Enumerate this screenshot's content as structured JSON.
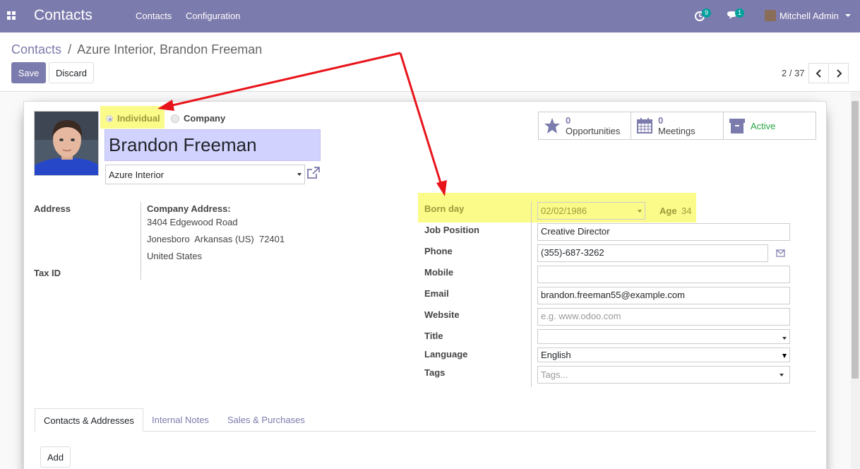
{
  "navbar": {
    "brand": "Contacts",
    "menu": [
      "Contacts",
      "Configuration"
    ],
    "activity_count": "9",
    "message_count": "1",
    "user": "Mitchell Admin"
  },
  "breadcrumb": {
    "parent": "Contacts",
    "separator": "/",
    "current": "Azure Interior, Brandon Freeman"
  },
  "actions": {
    "save": "Save",
    "discard": "Discard"
  },
  "pager": {
    "value": "2 / 37"
  },
  "form": {
    "type_individual": "Individual",
    "type_company": "Company",
    "name": "Brandon Freeman",
    "company": "Azure Interior",
    "stats": {
      "opportunities_count": "0",
      "opportunities_label": "Opportunities",
      "meetings_count": "0",
      "meetings_label": "Meetings",
      "active_label": "Active"
    },
    "left": {
      "address_label": "Address",
      "company_address_label": "Company Address:",
      "street": "3404 Edgewood Road",
      "city_line": "Jonesboro  Arkansas (US)  72401",
      "country": "United States",
      "tax_id_label": "Tax ID"
    },
    "right": {
      "born_day_label": "Born day",
      "born_day_value": "02/02/1986",
      "age_label": "Age",
      "age_value": "34",
      "job_position_label": "Job Position",
      "job_position_value": "Creative Director",
      "phone_label": "Phone",
      "phone_value": "(355)-687-3262",
      "mobile_label": "Mobile",
      "mobile_value": "",
      "email_label": "Email",
      "email_value": "brandon.freeman55@example.com",
      "website_label": "Website",
      "website_placeholder": "e.g. www.odoo.com",
      "title_label": "Title",
      "title_value": "",
      "language_label": "Language",
      "language_value": "English",
      "tags_label": "Tags",
      "tags_placeholder": "Tags..."
    },
    "tabs": [
      "Contacts & Addresses",
      "Internal Notes",
      "Sales & Purchases"
    ],
    "add_button": "Add"
  },
  "colors": {
    "brand": "#7c7bad",
    "highlight": "#fbfb8a",
    "annotation_arrow": "#e8141b",
    "active_green": "#28a745"
  }
}
